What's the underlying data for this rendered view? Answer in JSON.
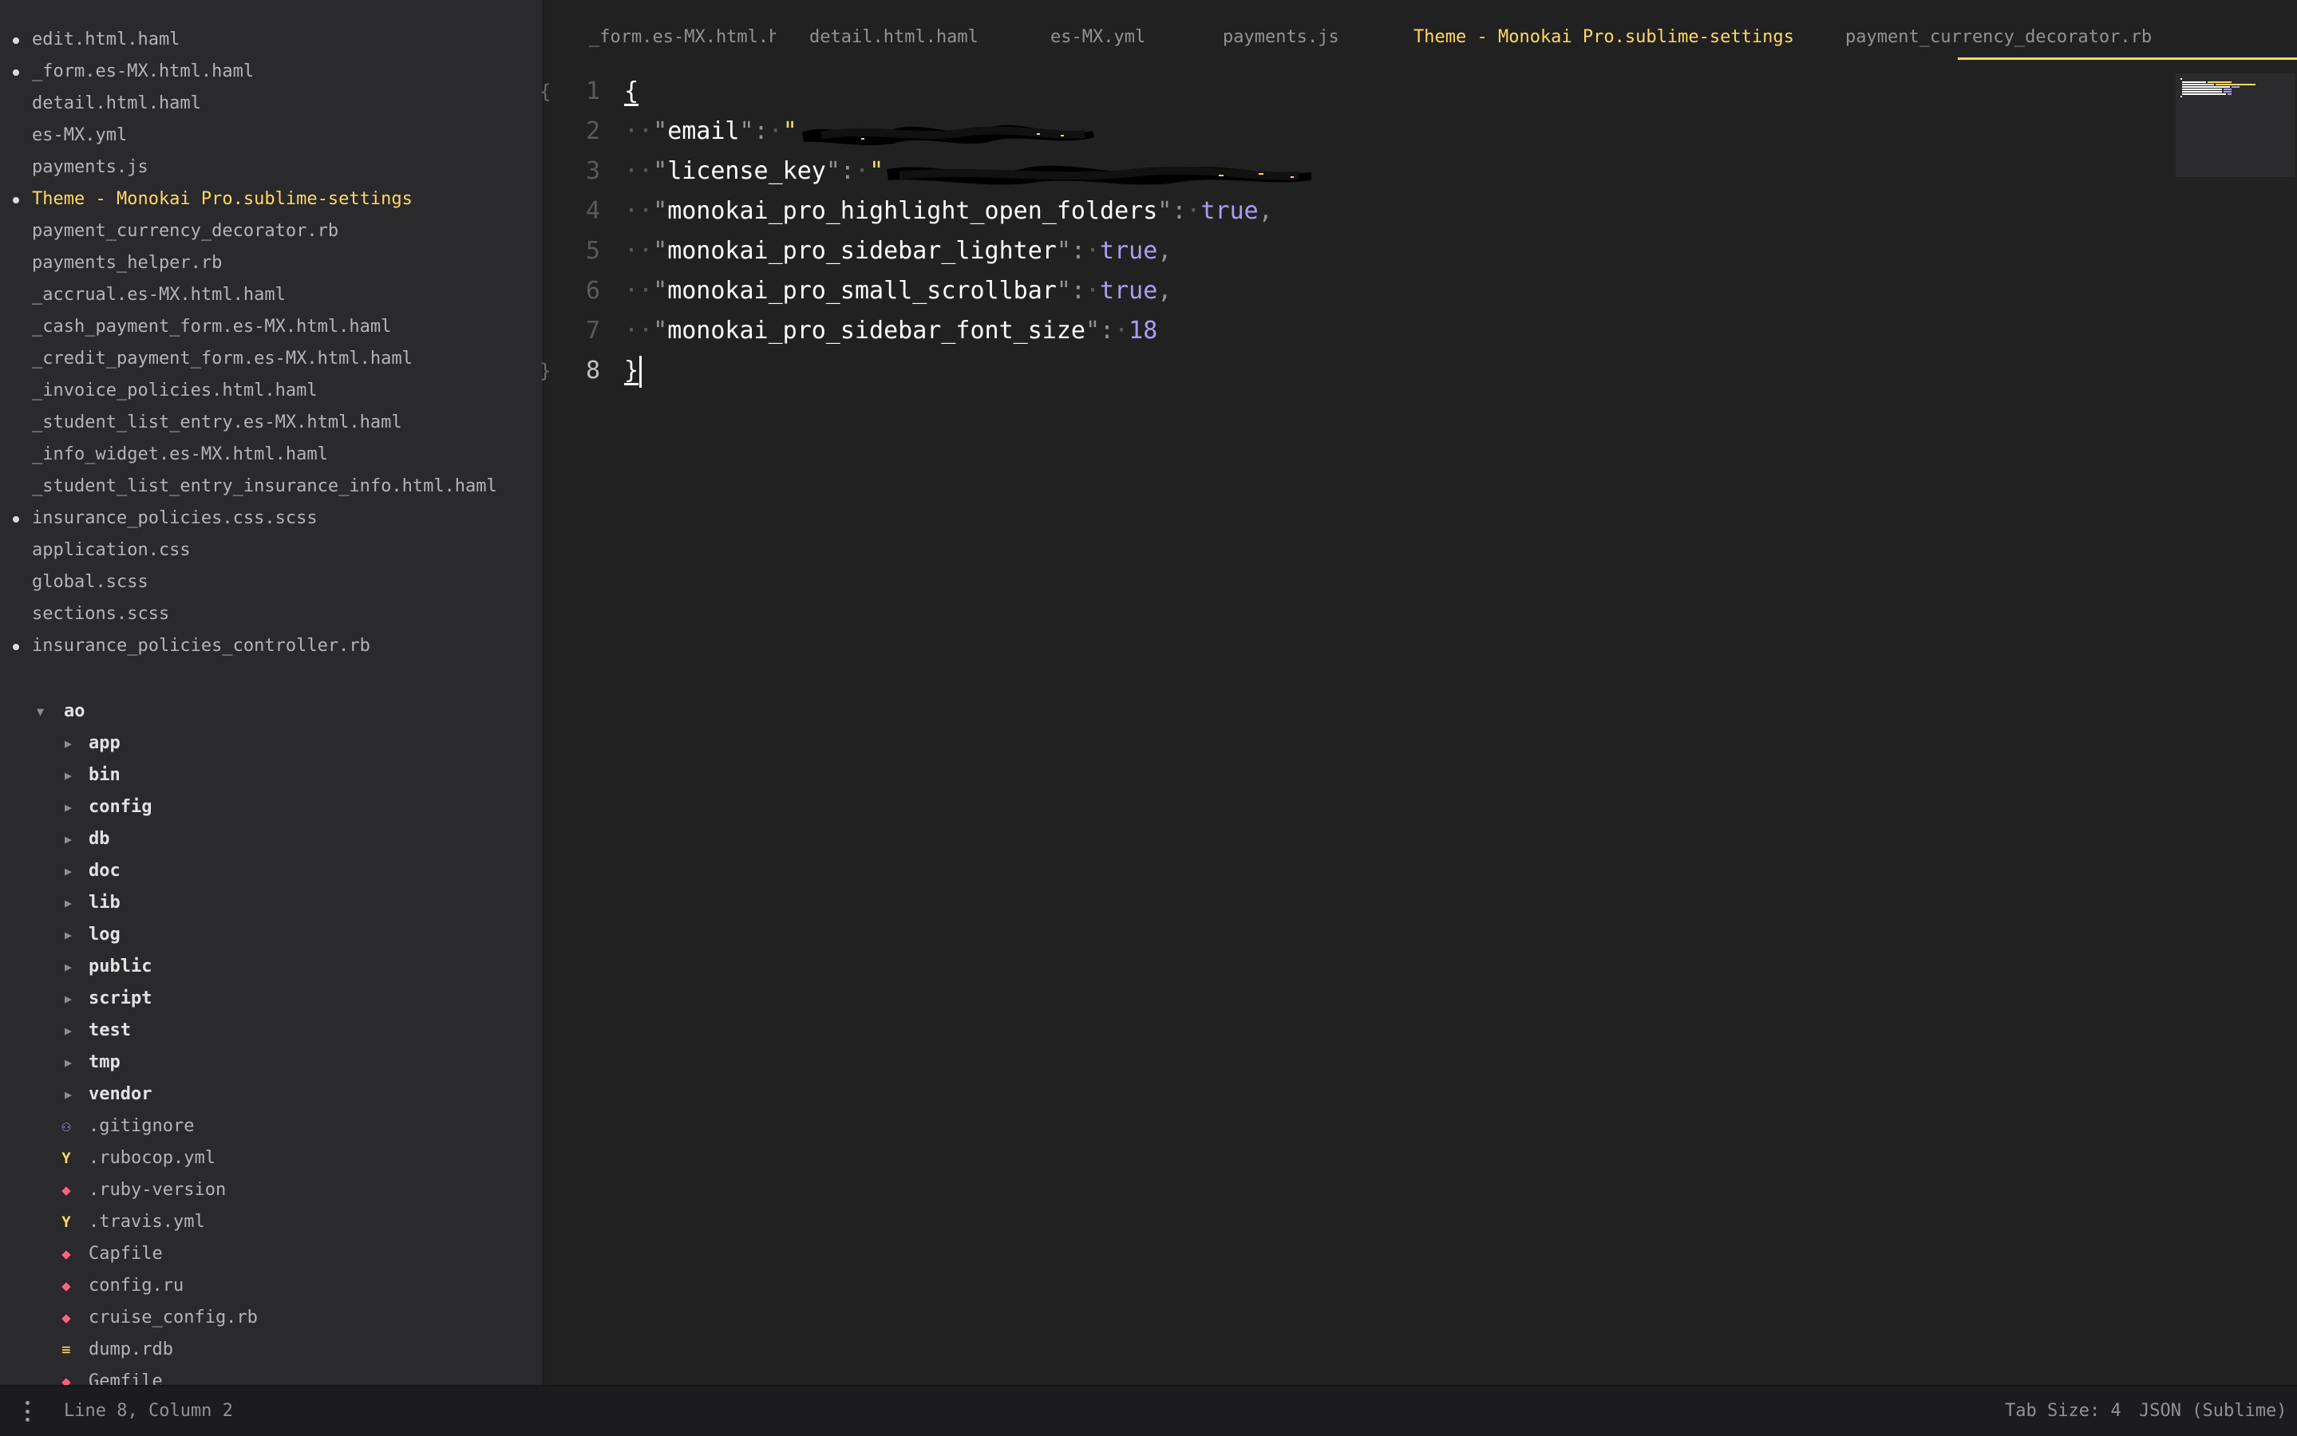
{
  "open_files": [
    {
      "name": "edit.html.haml",
      "modified": true,
      "active": false
    },
    {
      "name": "_form.es-MX.html.haml",
      "modified": true,
      "active": false
    },
    {
      "name": "detail.html.haml",
      "modified": false,
      "active": false
    },
    {
      "name": "es-MX.yml",
      "modified": false,
      "active": false
    },
    {
      "name": "payments.js",
      "modified": false,
      "active": false
    },
    {
      "name": "Theme - Monokai Pro.sublime-settings",
      "modified": true,
      "active": true
    },
    {
      "name": "payment_currency_decorator.rb",
      "modified": false,
      "active": false
    },
    {
      "name": "payments_helper.rb",
      "modified": false,
      "active": false
    },
    {
      "name": "_accrual.es-MX.html.haml",
      "modified": false,
      "active": false
    },
    {
      "name": "_cash_payment_form.es-MX.html.haml",
      "modified": false,
      "active": false
    },
    {
      "name": "_credit_payment_form.es-MX.html.haml",
      "modified": false,
      "active": false
    },
    {
      "name": "_invoice_policies.html.haml",
      "modified": false,
      "active": false
    },
    {
      "name": "_student_list_entry.es-MX.html.haml",
      "modified": false,
      "active": false
    },
    {
      "name": "_info_widget.es-MX.html.haml",
      "modified": false,
      "active": false
    },
    {
      "name": "_student_list_entry_insurance_info.html.haml",
      "modified": false,
      "active": false
    },
    {
      "name": "insurance_policies.css.scss",
      "modified": true,
      "active": false
    },
    {
      "name": "application.css",
      "modified": false,
      "active": false
    },
    {
      "name": "global.scss",
      "modified": false,
      "active": false
    },
    {
      "name": "sections.scss",
      "modified": false,
      "active": false
    },
    {
      "name": "insurance_policies_controller.rb",
      "modified": true,
      "active": false
    }
  ],
  "folder_tree": {
    "root": {
      "name": "ao",
      "expanded": true,
      "icon": "triangle-down-icon"
    },
    "folders": [
      "app",
      "bin",
      "config",
      "db",
      "doc",
      "lib",
      "log",
      "public",
      "script",
      "test",
      "tmp",
      "vendor"
    ],
    "files": [
      {
        "name": ".gitignore",
        "icon": "github-icon"
      },
      {
        "name": ".rubocop.yml",
        "icon": "yaml-icon"
      },
      {
        "name": ".ruby-version",
        "icon": "ruby-icon"
      },
      {
        "name": ".travis.yml",
        "icon": "yaml-icon"
      },
      {
        "name": "Capfile",
        "icon": "ruby-icon"
      },
      {
        "name": "config.ru",
        "icon": "ruby-icon"
      },
      {
        "name": "cruise_config.rb",
        "icon": "ruby-icon"
      },
      {
        "name": "dump.rdb",
        "icon": "database-icon"
      },
      {
        "name": "Gemfile",
        "icon": "ruby-icon"
      }
    ]
  },
  "tabs": [
    {
      "label": "_form.es-MX.html.haml",
      "active": false,
      "modified": false
    },
    {
      "label": "detail.html.haml",
      "active": false,
      "modified": false
    },
    {
      "label": "es-MX.yml",
      "active": false,
      "modified": false
    },
    {
      "label": "payments.js",
      "active": false,
      "modified": false
    },
    {
      "label": "Theme - Monokai Pro.sublime-settings",
      "active": true,
      "modified": true
    },
    {
      "label": "payment_currency_decorator.rb",
      "active": false,
      "modified": false
    }
  ],
  "editor": {
    "line_numbers": [
      "1",
      "2",
      "3",
      "4",
      "5",
      "6",
      "7",
      "8"
    ],
    "current_line": 8,
    "code": {
      "open_brace": "{",
      "close_brace": "}",
      "lines": [
        {
          "key": "email",
          "type": "redacted_string"
        },
        {
          "key": "license_key",
          "type": "redacted_string"
        },
        {
          "key": "monokai_pro_highlight_open_folders",
          "value": "true",
          "comma": true
        },
        {
          "key": "monokai_pro_sidebar_lighter",
          "value": "true",
          "comma": true
        },
        {
          "key": "monokai_pro_small_scrollbar",
          "value": "true",
          "comma": true
        },
        {
          "key": "monokai_pro_sidebar_font_size",
          "value": "18",
          "comma": false
        }
      ]
    }
  },
  "status": {
    "cursor_position": "Line 8, Column 2",
    "tab_size": "Tab Size: 4",
    "syntax": "JSON (Sublime)"
  },
  "colors": {
    "background": "#222122",
    "sidebar": "#2a292b",
    "accent": "#ffd866",
    "constant": "#ab9df2",
    "ruby_icon": "#ff6188"
  }
}
